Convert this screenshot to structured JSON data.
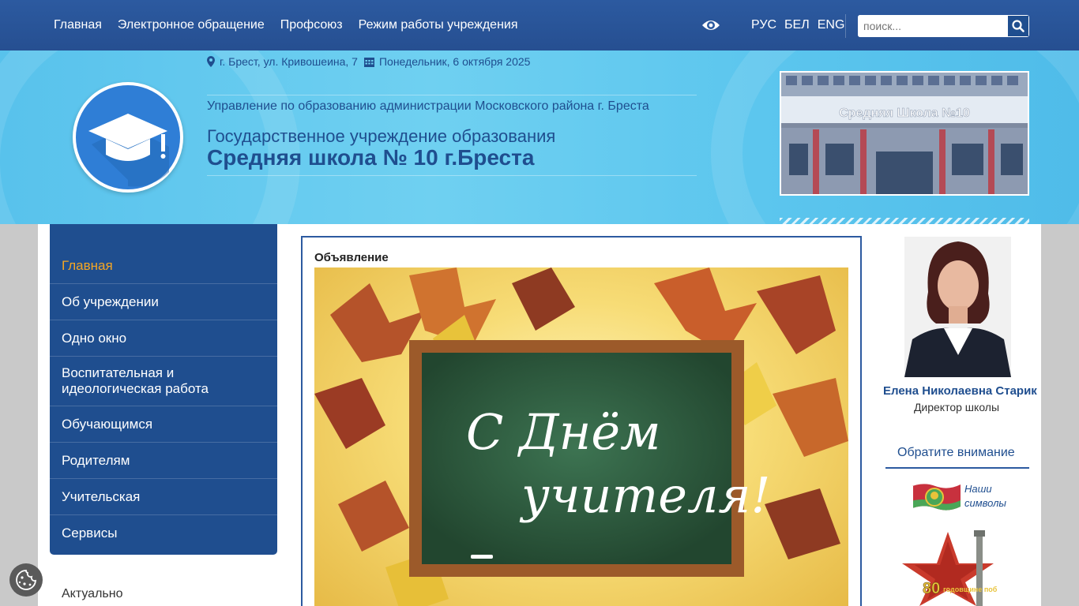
{
  "topnav": {
    "items": [
      "Главная",
      "Электронное обращение",
      "Профсоюз",
      "Режим работы учреждения"
    ],
    "langs": [
      "РУС",
      "БЕЛ",
      "ENG"
    ],
    "search_placeholder": "поиск..."
  },
  "header": {
    "address": "г. Брест, ул. Кривошеина, 7",
    "date": "Понедельник, 6 октября 2025",
    "org_parent": "Управление по образованию администрации Московского района г. Бреста",
    "org_type": "Государственное учреждение образования",
    "org_name": "Средняя школа № 10 г.Бреста",
    "building_sign": "Средняя Школа №10"
  },
  "sidebar": {
    "items": [
      {
        "label": "Главная",
        "active": true
      },
      {
        "label": "Об учреждении"
      },
      {
        "label": "Одно окно"
      },
      {
        "label": "Воспитательная и идеологическая работа"
      },
      {
        "label": "Обучающимся"
      },
      {
        "label": "Родителям"
      },
      {
        "label": "Учительская"
      },
      {
        "label": "Сервисы"
      }
    ],
    "section_below": "Актуально"
  },
  "main": {
    "title": "Объявление",
    "banner_line1": "С Днём",
    "banner_line2": "учителя!"
  },
  "right": {
    "director_name": "Елена Николаевна Старик",
    "director_role": "Директор школы",
    "attention_title": "Обратите внимание",
    "symbols_line1": "Наши",
    "symbols_line2": "символы",
    "victory_number": "80",
    "victory_text": "годовщине победы"
  },
  "colors": {
    "brand_blue": "#1f4e8f",
    "active_menu": "#f5a623",
    "header_sky": "#5cc6ee"
  }
}
